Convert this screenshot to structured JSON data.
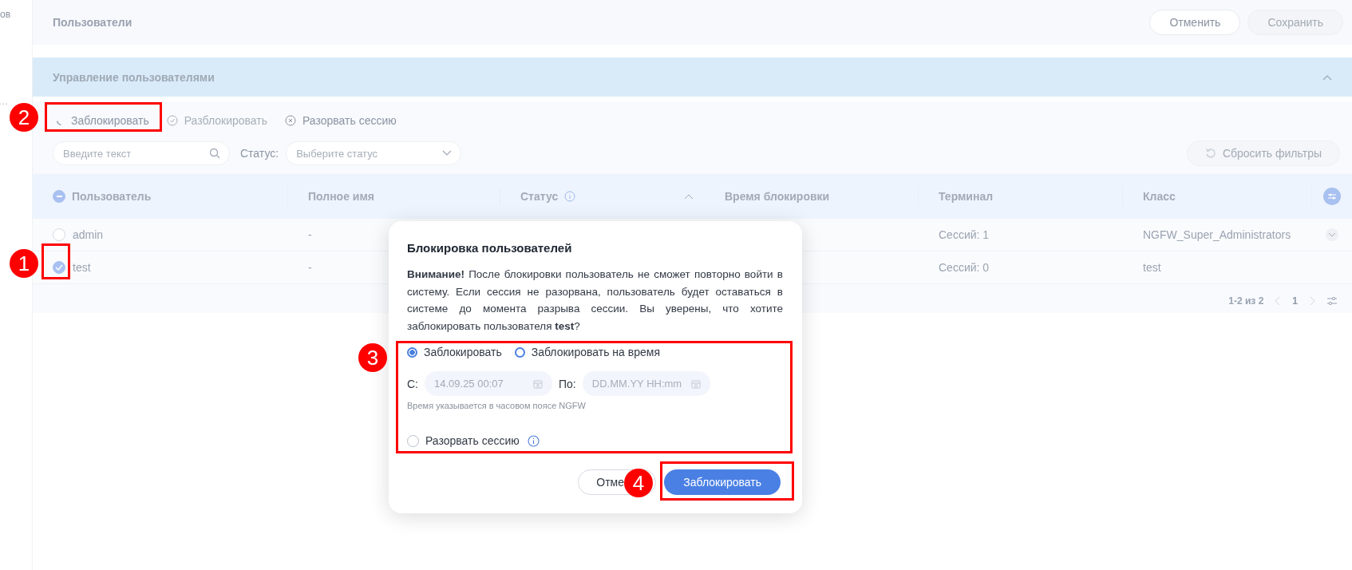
{
  "sidebar": {
    "label_top": "ов",
    "more": "…"
  },
  "header": {
    "title": "Пользователи",
    "buttons": [
      {
        "label": "Отменить",
        "disabled": false
      },
      {
        "label": "Сохранить",
        "disabled": true
      }
    ]
  },
  "section": {
    "title": "Управление пользователями",
    "expanded": true
  },
  "toolbar": [
    {
      "label": "Заблокировать",
      "kind": "loading",
      "disabled": false
    },
    {
      "label": "Разблокировать",
      "kind": "check",
      "disabled": true
    },
    {
      "label": "Разорвать сессию",
      "kind": "close",
      "disabled": false
    }
  ],
  "filters": {
    "search": {
      "placeholder": "Введите текст"
    },
    "status_label": "Статус:",
    "status": {
      "placeholder": "Выберите статус"
    },
    "reset": "Сбросить фильтры"
  },
  "table": {
    "select_all_indeterminate": true,
    "columns": [
      {
        "label": "Пользователь"
      },
      {
        "label": "Полное имя"
      },
      {
        "label": "Статус",
        "info": true,
        "sorted": true
      },
      {
        "label": "Время блокировки"
      },
      {
        "label": "Терминал"
      },
      {
        "label": "Класс"
      }
    ],
    "rows": [
      {
        "checked": false,
        "user": "admin",
        "full_name": "-",
        "terminal": "Сессий: 1",
        "class": "NGFW_Super_Administrators",
        "expandable": true
      },
      {
        "checked": true,
        "user": "test",
        "full_name": "-",
        "terminal": "Сессий: 0",
        "class": "test",
        "expandable": false
      }
    ]
  },
  "pagination": {
    "range": "1-2 из 2",
    "page": "1"
  },
  "dialog": {
    "title": "Блокировка пользователей",
    "message": "**Внимание!** После блокировки пользователь не сможет повторно войти в систему. Если сессия не разорвана, пользователь будет оставаться в системе до момента разрыва сессии. Вы уверены, что хотите заблокировать пользователя **test**?",
    "options": [
      {
        "label": "Заблокировать",
        "selected": true
      },
      {
        "label": "Заблокировать на время",
        "selected": false
      }
    ],
    "from_label": "С:",
    "from": {
      "value": "14.09.25 00:07"
    },
    "to_label": "По:",
    "to": {
      "placeholder": "DD.MM.YY HH:mm"
    },
    "hint": "Время указывается в часовом поясе NGFW",
    "break_session": {
      "label": "Разорвать сессию",
      "checked": false
    },
    "cancel": "Отме",
    "confirm": "Заблокировать"
  },
  "annotations": [
    {
      "number": "1"
    },
    {
      "number": "2"
    },
    {
      "number": "3"
    },
    {
      "number": "4"
    }
  ]
}
